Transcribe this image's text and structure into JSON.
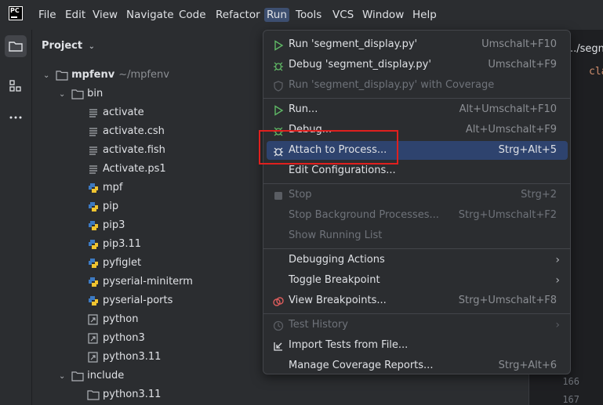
{
  "menubar": {
    "items": [
      "File",
      "Edit",
      "View",
      "Navigate",
      "Code",
      "Refactor",
      "Run",
      "Tools",
      "VCS",
      "Window",
      "Help"
    ],
    "active": "Run"
  },
  "logo_text": "PC",
  "project": {
    "title": "Project",
    "root": {
      "name": "mpfenv",
      "hint": "~/mpfenv"
    },
    "bin_folder": "bin",
    "bin_items": [
      {
        "name": "activate",
        "icon": "text-file-icon"
      },
      {
        "name": "activate.csh",
        "icon": "text-file-icon"
      },
      {
        "name": "activate.fish",
        "icon": "text-file-icon"
      },
      {
        "name": "Activate.ps1",
        "icon": "text-file-icon"
      },
      {
        "name": "mpf",
        "icon": "python-file-icon"
      },
      {
        "name": "pip",
        "icon": "python-file-icon"
      },
      {
        "name": "pip3",
        "icon": "python-file-icon"
      },
      {
        "name": "pip3.11",
        "icon": "python-file-icon"
      },
      {
        "name": "pyfiglet",
        "icon": "python-file-icon"
      },
      {
        "name": "pyserial-miniterm",
        "icon": "python-file-icon"
      },
      {
        "name": "pyserial-ports",
        "icon": "python-file-icon"
      },
      {
        "name": "python",
        "icon": "symlink-file-icon"
      },
      {
        "name": "python3",
        "icon": "symlink-file-icon"
      },
      {
        "name": "python3.11",
        "icon": "symlink-file-icon"
      }
    ],
    "include_folder": "include",
    "include_items": [
      {
        "name": "python3.11",
        "icon": "folder-icon"
      }
    ]
  },
  "editor": {
    "tab_fragment": "../segn",
    "code_fragment": "cla",
    "line_numbers": [
      "166",
      "167"
    ]
  },
  "run_menu": {
    "groups": [
      [
        {
          "label": "Run 'segment_display.py'",
          "shortcut": "Umschalt+F10",
          "icon": "run-icon",
          "disabled": false
        },
        {
          "label": "Debug 'segment_display.py'",
          "shortcut": "Umschalt+F9",
          "icon": "debug-icon",
          "disabled": false
        },
        {
          "label": "Run 'segment_display.py' with Coverage",
          "shortcut": "",
          "icon": "coverage-icon",
          "disabled": true
        }
      ],
      [
        {
          "label": "Run...",
          "shortcut": "Alt+Umschalt+F10",
          "icon": "run-icon",
          "disabled": false
        },
        {
          "label": "Debug...",
          "shortcut": "Alt+Umschalt+F9",
          "icon": "debug-icon",
          "disabled": false
        },
        {
          "label": "Attach to Process...",
          "shortcut": "Strg+Alt+5",
          "icon": "attach-debug-icon",
          "disabled": false,
          "highlighted": true
        },
        {
          "label": "Edit Configurations...",
          "shortcut": "",
          "icon": "",
          "disabled": false
        }
      ],
      [
        {
          "label": "Stop",
          "shortcut": "Strg+2",
          "icon": "stop-icon",
          "disabled": true
        },
        {
          "label": "Stop Background Processes...",
          "shortcut": "Strg+Umschalt+F2",
          "icon": "",
          "disabled": true
        },
        {
          "label": "Show Running List",
          "shortcut": "",
          "icon": "",
          "disabled": true
        }
      ],
      [
        {
          "label": "Debugging Actions",
          "shortcut": "",
          "icon": "",
          "disabled": false,
          "submenu": true
        },
        {
          "label": "Toggle Breakpoint",
          "shortcut": "",
          "icon": "",
          "disabled": false,
          "submenu": true
        },
        {
          "label": "View Breakpoints...",
          "shortcut": "Strg+Umschalt+F8",
          "icon": "breakpoints-icon",
          "disabled": false
        }
      ],
      [
        {
          "label": "Test History",
          "shortcut": "",
          "icon": "history-icon",
          "disabled": true,
          "submenu": true
        },
        {
          "label": "Import Tests from File...",
          "shortcut": "",
          "icon": "import-icon",
          "disabled": false
        },
        {
          "label": "Manage Coverage Reports...",
          "shortcut": "Strg+Alt+6",
          "icon": "",
          "disabled": false
        }
      ]
    ]
  },
  "colors": {
    "highlight": "#2e436e",
    "annotation_box": "#e0201e",
    "run_green": "#5fb865",
    "folder": "#b0b3b8"
  }
}
